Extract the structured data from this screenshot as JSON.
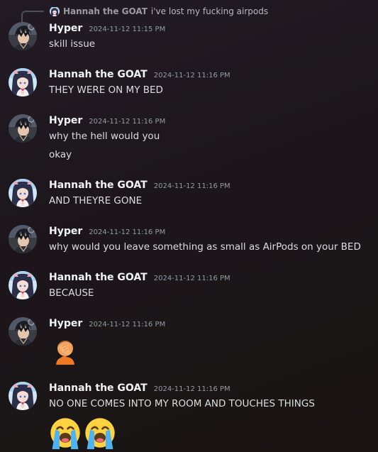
{
  "reply": {
    "author": "Hannah the GOAT",
    "text": "i've lost my fucking airpods"
  },
  "messages": [
    {
      "author": "Hyper",
      "timestamp": "2024-11-12 11:15 PM",
      "lines": [
        "skill issue"
      ]
    },
    {
      "author": "Hannah the GOAT",
      "timestamp": "2024-11-12 11:16 PM",
      "lines": [
        "THEY WERE ON MY BED"
      ]
    },
    {
      "author": "Hyper",
      "timestamp": "2024-11-12 11:16 PM",
      "lines": [
        "why the hell would you",
        "okay"
      ]
    },
    {
      "author": "Hannah the GOAT",
      "timestamp": "2024-11-12 11:16 PM",
      "lines": [
        "AND THEYRE GONE"
      ]
    },
    {
      "author": "Hyper",
      "timestamp": "2024-11-12 11:16 PM",
      "lines": [
        "why would you leave something as small as AirPods on your BED"
      ]
    },
    {
      "author": "Hannah the GOAT",
      "timestamp": "2024-11-12 11:16 PM",
      "lines": [
        "BECAUSE"
      ]
    },
    {
      "author": "Hyper",
      "timestamp": "2024-11-12 11:16 PM",
      "emoji": [
        "face-palm-emoji"
      ]
    },
    {
      "author": "Hannah the GOAT",
      "timestamp": "2024-11-12 11:16 PM",
      "lines": [
        "NO ONE COMES INTO MY ROOM AND TOUCHES THINGS"
      ],
      "emoji": [
        "loudly-crying-face-emoji",
        "loudly-crying-face-emoji"
      ]
    }
  ],
  "colors": {
    "author": "#f2f3f5",
    "timestamp": "#949ba4",
    "text": "#dbdee1",
    "background": "#1f181f"
  }
}
